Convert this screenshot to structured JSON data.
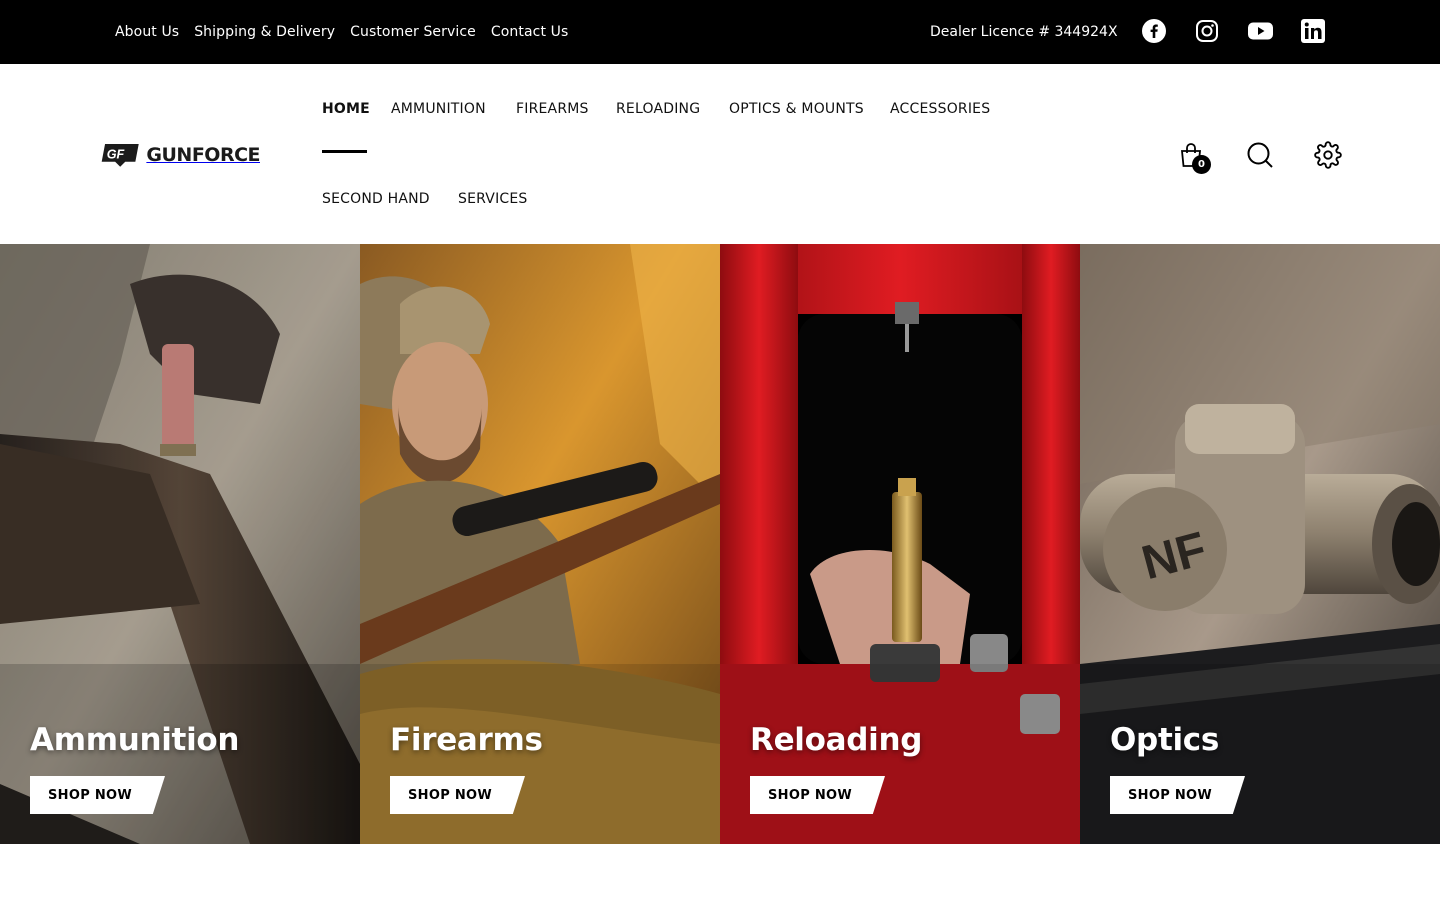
{
  "topbar": {
    "links": [
      "About Us",
      "Shipping & Delivery",
      "Customer Service",
      "Contact Us"
    ],
    "dealer_licence": "Dealer Licence # 344924X",
    "social_icons": [
      "facebook-icon",
      "instagram-icon",
      "youtube-icon",
      "linkedin-icon"
    ]
  },
  "header": {
    "logo_mark": "GF",
    "logo_text": "GUNFORCE",
    "nav": [
      "HOME",
      "AMMUNITION",
      "FIREARMS",
      "RELOADING",
      "OPTICS & MOUNTS",
      "ACCESSORIES",
      "SECOND HAND",
      "SERVICES"
    ],
    "active_nav": "HOME",
    "cart_count": "0",
    "icons": [
      "shopping-bag-icon",
      "search-icon",
      "settings-gear-icon"
    ]
  },
  "categories": [
    {
      "title": "Ammunition",
      "button": "SHOP NOW"
    },
    {
      "title": "Firearms",
      "button": "SHOP NOW"
    },
    {
      "title": "Reloading",
      "button": "SHOP NOW"
    },
    {
      "title": "Optics",
      "button": "SHOP NOW"
    }
  ],
  "colors": {
    "topbar_bg": "#000000",
    "header_bg": "#ffffff",
    "reloading_red": "#c8141c",
    "firearms_orange": "#c8862a"
  }
}
